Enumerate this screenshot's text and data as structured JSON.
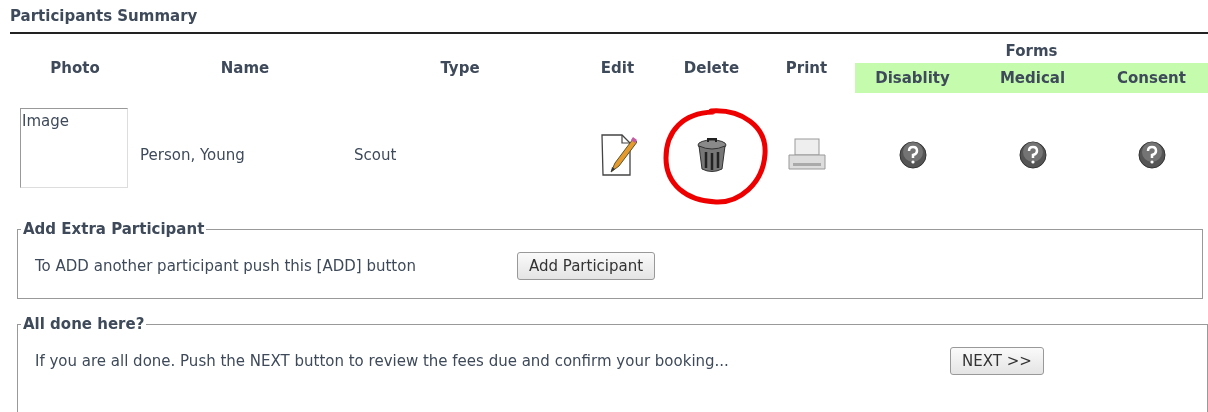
{
  "section_title": "Participants Summary",
  "columns": {
    "photo": "Photo",
    "name": "Name",
    "type": "Type",
    "edit": "Edit",
    "delete": "Delete",
    "print": "Print"
  },
  "forms": {
    "title": "Forms",
    "columns": [
      "Disablity",
      "Medical",
      "Consent"
    ]
  },
  "rows": [
    {
      "photo_alt": "Image",
      "name": "Person, Young",
      "type": "Scout",
      "delete_circled": true,
      "forms": [
        {
          "kind": "question"
        },
        {
          "kind": "question"
        },
        {
          "kind": "question"
        }
      ]
    }
  ],
  "add_section": {
    "legend": "Add Extra Participant",
    "text": "To ADD another participant push this [ADD] button",
    "button": "Add Participant"
  },
  "done_section": {
    "legend": "All done here?",
    "text": "If you are all done. Push the NEXT button to review the fees due and confirm your booking...",
    "button": "NEXT >>"
  }
}
